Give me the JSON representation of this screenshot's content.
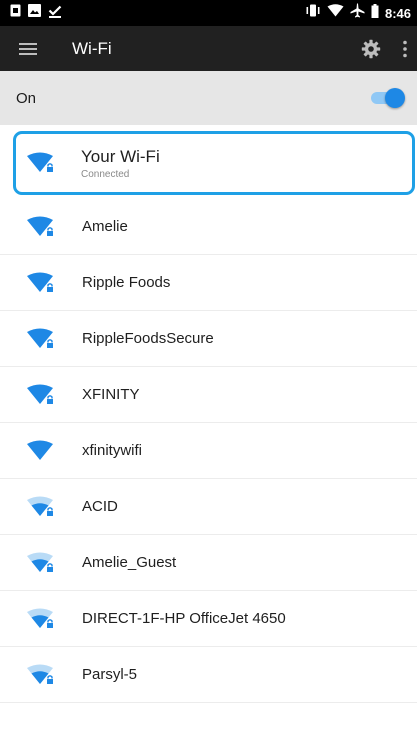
{
  "status_bar": {
    "time": "8:46",
    "left_icons": [
      "notification-icon",
      "image-icon",
      "download-done-icon"
    ],
    "right_icons": [
      "vibrate-icon",
      "wifi-status-icon",
      "airplane-icon",
      "battery-icon"
    ]
  },
  "app_bar": {
    "title": "Wi-Fi",
    "menu_icon": "hamburger-menu-icon",
    "settings_icon": "gear-icon",
    "overflow_icon": "more-vert-icon"
  },
  "master_switch": {
    "label": "On",
    "state": "on"
  },
  "networks": [
    {
      "ssid": "Your Wi-Fi",
      "status": "Connected",
      "secured": true,
      "signal": "full",
      "highlighted": true
    },
    {
      "ssid": "Amelie",
      "status": "",
      "secured": true,
      "signal": "full"
    },
    {
      "ssid": "Ripple Foods",
      "status": "",
      "secured": true,
      "signal": "full"
    },
    {
      "ssid": "RippleFoodsSecure",
      "status": "",
      "secured": true,
      "signal": "full"
    },
    {
      "ssid": "XFINITY",
      "status": "",
      "secured": true,
      "signal": "full"
    },
    {
      "ssid": "xfinitywifi",
      "status": "",
      "secured": false,
      "signal": "full"
    },
    {
      "ssid": "ACID",
      "status": "",
      "secured": true,
      "signal": "medium"
    },
    {
      "ssid": "Amelie_Guest",
      "status": "",
      "secured": true,
      "signal": "medium"
    },
    {
      "ssid": "DIRECT-1F-HP OfficeJet 4650",
      "status": "",
      "secured": true,
      "signal": "medium"
    },
    {
      "ssid": "Parsyl-5",
      "status": "",
      "secured": true,
      "signal": "medium"
    }
  ],
  "colors": {
    "accent": "#1e88e5",
    "highlight_border": "#1ea0e6",
    "app_bar": "#212121",
    "switch_bar": "#e6e6e6",
    "wifi_strong": "#1e88e5",
    "wifi_weak_fill": "#b9dbf6"
  }
}
